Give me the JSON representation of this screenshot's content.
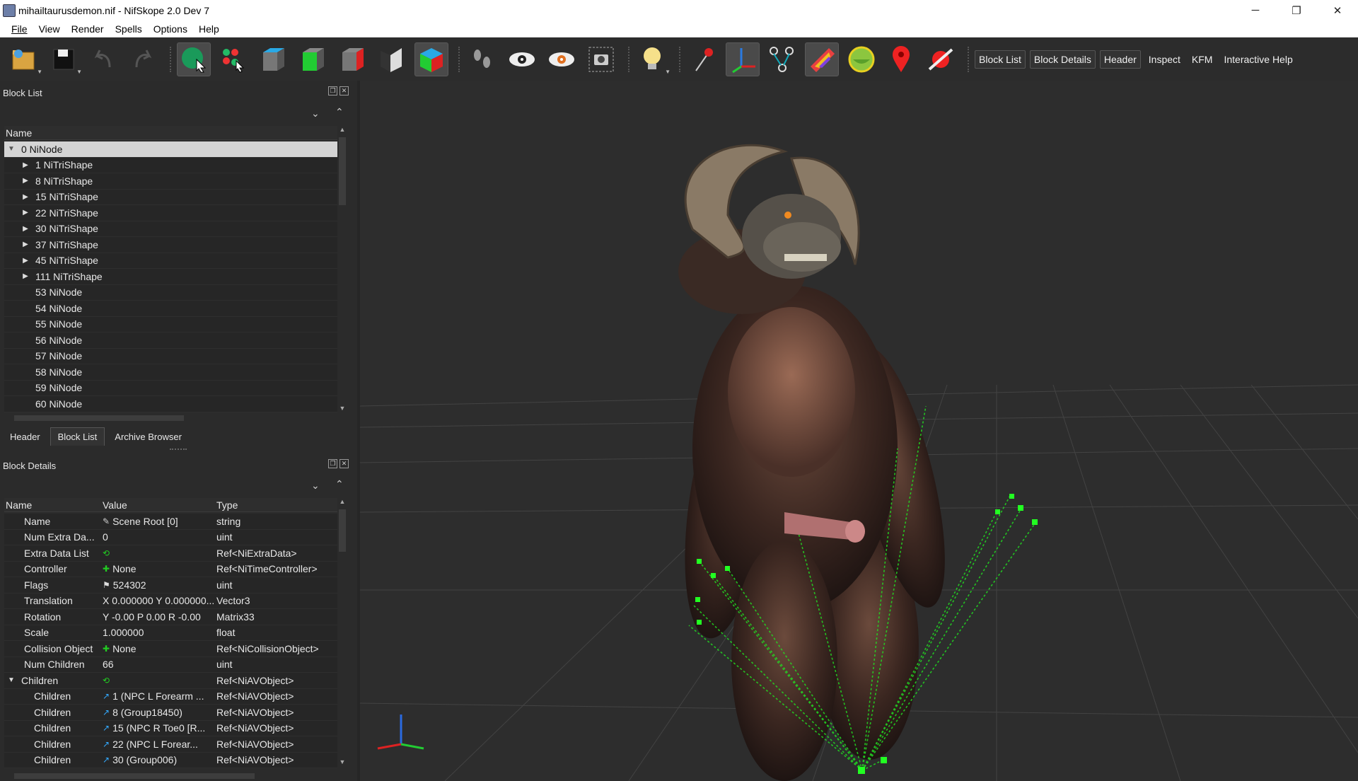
{
  "window": {
    "title": "mihailtaurusdemon.nif - NifSkope 2.0 Dev 7",
    "min_glyph": "─",
    "max_glyph": "❐",
    "close_glyph": "✕"
  },
  "menu": [
    "File",
    "View",
    "Render",
    "Spells",
    "Options",
    "Help"
  ],
  "toolbar": {
    "icons": [
      "open-icon",
      "save-icon",
      "undo-icon",
      "redo-icon",
      "select-object-icon",
      "select-vertex-icon",
      "view-top-icon",
      "view-front-icon",
      "view-side-icon",
      "view-user-icon",
      "view-perspective-icon",
      "footprints-icon",
      "visibility-icon",
      "hidden-visibility-icon",
      "screenshot-icon",
      "light-icon",
      "pin-icon",
      "axes-icon",
      "nodes-icon",
      "flip-icon",
      "lighting-icon",
      "marker-icon",
      "disable-icon"
    ],
    "dock_toggles": [
      "Block List",
      "Block Details",
      "Header",
      "Inspect",
      "KFM",
      "Interactive Help"
    ]
  },
  "block_list": {
    "title": "Block List",
    "column": "Name",
    "rows": [
      {
        "label": "0 NiNode",
        "expanded": true,
        "selected": true,
        "indent": 0,
        "has_children": true
      },
      {
        "label": "1 NiTriShape",
        "indent": 1,
        "has_children": true
      },
      {
        "label": "8 NiTriShape",
        "indent": 1,
        "has_children": true
      },
      {
        "label": "15 NiTriShape",
        "indent": 1,
        "has_children": true
      },
      {
        "label": "22 NiTriShape",
        "indent": 1,
        "has_children": true
      },
      {
        "label": "30 NiTriShape",
        "indent": 1,
        "has_children": true
      },
      {
        "label": "37 NiTriShape",
        "indent": 1,
        "has_children": true
      },
      {
        "label": "45 NiTriShape",
        "indent": 1,
        "has_children": true
      },
      {
        "label": "111 NiTriShape",
        "indent": 1,
        "has_children": true
      },
      {
        "label": "53 NiNode",
        "indent": 1,
        "has_children": false
      },
      {
        "label": "54 NiNode",
        "indent": 1,
        "has_children": false
      },
      {
        "label": "55 NiNode",
        "indent": 1,
        "has_children": false
      },
      {
        "label": "56 NiNode",
        "indent": 1,
        "has_children": false
      },
      {
        "label": "57 NiNode",
        "indent": 1,
        "has_children": false
      },
      {
        "label": "58 NiNode",
        "indent": 1,
        "has_children": false
      },
      {
        "label": "59 NiNode",
        "indent": 1,
        "has_children": false
      },
      {
        "label": "60 NiNode",
        "indent": 1,
        "has_children": false
      }
    ]
  },
  "tabs": [
    {
      "label": "Header"
    },
    {
      "label": "Block List",
      "active": true
    },
    {
      "label": "Archive Browser"
    }
  ],
  "block_details": {
    "title": "Block Details",
    "columns": [
      "Name",
      "Value",
      "Type"
    ],
    "rows": [
      {
        "name": "Name",
        "icon": "text-icon",
        "value": "Scene Root [0]",
        "type": "string",
        "indent": 1
      },
      {
        "name": "Num Extra Da...",
        "icon": "",
        "value": "0",
        "type": "uint",
        "indent": 1
      },
      {
        "name": "Extra Data List",
        "icon": "link-group-icon",
        "value": "",
        "type": "Ref<NiExtraData>",
        "indent": 1
      },
      {
        "name": "Controller",
        "icon": "add-icon",
        "value": "None",
        "type": "Ref<NiTimeController>",
        "indent": 1
      },
      {
        "name": "Flags",
        "icon": "flag-icon",
        "value": "524302",
        "type": "uint",
        "indent": 1
      },
      {
        "name": "Translation",
        "icon": "",
        "value": "X 0.000000 Y 0.000000...",
        "type": "Vector3",
        "indent": 1
      },
      {
        "name": "Rotation",
        "icon": "",
        "value": "Y -0.00 P 0.00 R -0.00",
        "type": "Matrix33",
        "indent": 1
      },
      {
        "name": "Scale",
        "icon": "",
        "value": "1.000000",
        "type": "float",
        "indent": 1
      },
      {
        "name": "Collision Object",
        "icon": "add-icon",
        "value": "None",
        "type": "Ref<NiCollisionObject>",
        "indent": 1
      },
      {
        "name": "Num Children",
        "icon": "",
        "value": "66",
        "type": "uint",
        "indent": 1
      },
      {
        "name": "Children",
        "icon": "link-group-icon",
        "value": "",
        "type": "Ref<NiAVObject>",
        "indent": 1,
        "expanded": true
      },
      {
        "name": "Children",
        "icon": "link-icon",
        "value": "1 (NPC L Forearm ...",
        "type": "Ref<NiAVObject>",
        "indent": 2
      },
      {
        "name": "Children",
        "icon": "link-icon",
        "value": "8 (Group18450)",
        "type": "Ref<NiAVObject>",
        "indent": 2
      },
      {
        "name": "Children",
        "icon": "link-icon",
        "value": "15 (NPC R Toe0 [R...",
        "type": "Ref<NiAVObject>",
        "indent": 2
      },
      {
        "name": "Children",
        "icon": "link-icon",
        "value": "22 (NPC L Forear...",
        "type": "Ref<NiAVObject>",
        "indent": 2
      },
      {
        "name": "Children",
        "icon": "link-icon",
        "value": "30 (Group006)",
        "type": "Ref<NiAVObject>",
        "indent": 2
      }
    ]
  },
  "colors": {
    "accent_green": "#22dd22",
    "viewport_bg": "#2d2d2d",
    "grid": "#555555",
    "selected_row": "#d4d4d4"
  }
}
